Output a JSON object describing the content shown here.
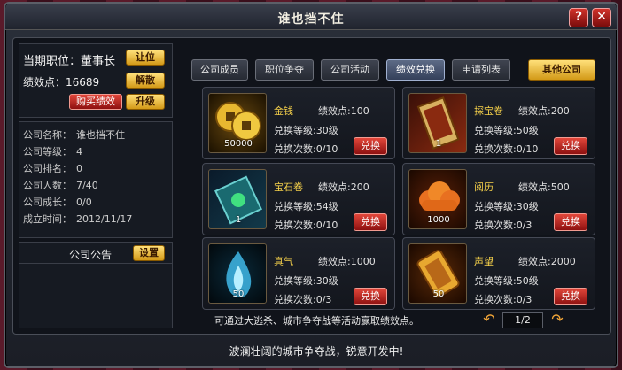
{
  "window": {
    "title": "谁也挡不住",
    "help_label": "?",
    "close_label": "✕"
  },
  "left": {
    "position_label": "当期职位：董事长",
    "perf_label": "绩效点：16689",
    "resign_label": "让位",
    "dismiss_label": "解散",
    "buy_perf_label": "购买绩效",
    "upgrade_label": "升级",
    "details": [
      {
        "key": "公司名称：",
        "value": "谁也挡不住"
      },
      {
        "key": "公司等级：",
        "value": "4"
      },
      {
        "key": "公司排名：",
        "value": "0"
      },
      {
        "key": "公司人数：",
        "value": "7/40"
      },
      {
        "key": "公司成长：",
        "value": "0/0"
      },
      {
        "key": "成立时间：",
        "value": "2012/11/17"
      }
    ],
    "notice_label": "公司公告",
    "setting_label": "设置"
  },
  "tabs": [
    {
      "label": "公司成员",
      "active": false
    },
    {
      "label": "职位争夺",
      "active": false
    },
    {
      "label": "公司活动",
      "active": false
    },
    {
      "label": "绩效兑换",
      "active": true
    },
    {
      "label": "申请列表",
      "active": false
    }
  ],
  "other_company_label": "其他公司",
  "items": [
    {
      "name": "金钱",
      "points": "绩效点:100",
      "level": "兑换等级:30级",
      "count": "兑换次数:0/10",
      "qty": "50000",
      "icon": "coins-icon",
      "button": "兑换"
    },
    {
      "name": "探宝卷",
      "points": "绩效点:200",
      "level": "兑换等级:50级",
      "count": "兑换次数:0/10",
      "qty": "1",
      "icon": "treasure-scroll-icon",
      "button": "兑换"
    },
    {
      "name": "宝石卷",
      "points": "绩效点:200",
      "level": "兑换等级:54级",
      "count": "兑换次数:0/10",
      "qty": "1",
      "icon": "gem-scroll-icon",
      "button": "兑换"
    },
    {
      "name": "阅历",
      "points": "绩效点:500",
      "level": "兑换等级:30级",
      "count": "兑换次数:0/3",
      "qty": "1000",
      "icon": "cloud-icon",
      "button": "兑换"
    },
    {
      "name": "真气",
      "points": "绩效点:1000",
      "level": "兑换等级:30级",
      "count": "兑换次数:0/3",
      "qty": "50",
      "icon": "flame-icon",
      "button": "兑换"
    },
    {
      "name": "声望",
      "points": "绩效点:2000",
      "level": "兑换等级:50级",
      "count": "兑换次数:0/3",
      "qty": "50",
      "icon": "token-icon",
      "button": "兑换"
    }
  ],
  "hint": "可通过大逃杀、城市争夺战等活动赢取绩效点。",
  "pager": {
    "page": "1/2",
    "prev": "↶",
    "next": "↷"
  },
  "footer": "波澜壮阔的城市争夺战，锐意开发中!"
}
